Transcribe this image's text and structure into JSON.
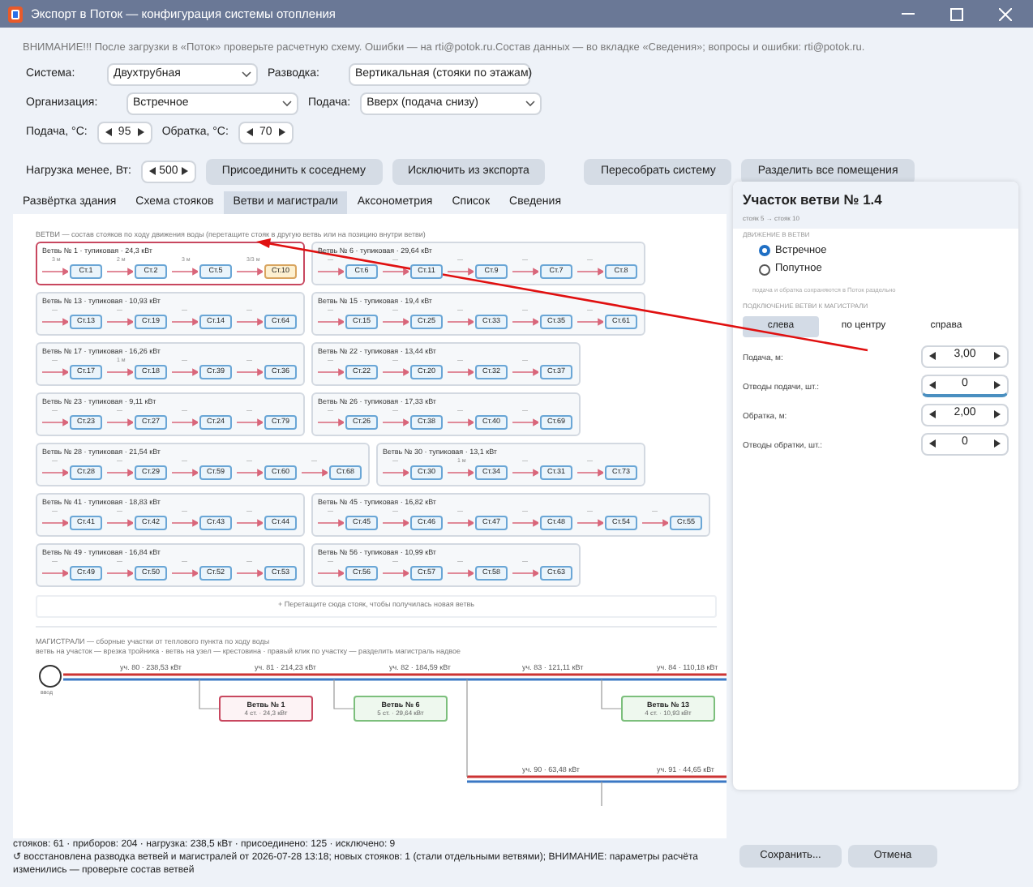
{
  "window": {
    "title": "Экспорт в Поток — конфигурация системы отопления"
  },
  "notice": "ВНИМАНИЕ!!! После загрузки в «Поток» проверьте расчетную схему. Ошибки — на rti@potok.ru.Состав данных — во вкладке «Сведения»; вопросы и ошибки: rti@potok.ru.",
  "form_rows": [
    [
      {
        "kind": "select",
        "label": "Система:",
        "value": "Двухтрубная"
      },
      {
        "kind": "select",
        "label": "Разводка:",
        "value": "Вертикальная (стояки по этажам)"
      }
    ],
    [
      {
        "kind": "select",
        "label": "Организация:",
        "value": "Встречное"
      },
      {
        "kind": "select",
        "label": "Подача:",
        "value": "Вверх (подача снизу)"
      }
    ],
    [
      {
        "kind": "spin",
        "label": "Подача, °C:",
        "value": "95"
      },
      {
        "kind": "spin",
        "label": "Обратка, °C:",
        "value": "70"
      }
    ],
    [
      {
        "kind": "spin",
        "label": "Нагрузка менее, Вт:",
        "value": "500"
      },
      {
        "kind": "button",
        "label": "Присоединить к соседнему"
      },
      {
        "kind": "button",
        "label": "Исключить из экспорта"
      },
      {
        "kind": "gap"
      },
      {
        "kind": "button",
        "label": "Пересобрать систему"
      },
      {
        "kind": "button",
        "label": "Разделить все помещения"
      }
    ]
  ],
  "tabs": [
    {
      "label": "Развёртка здания",
      "selected": false
    },
    {
      "label": "Схема стояков",
      "selected": false
    },
    {
      "label": "Ветви и магистрали",
      "selected": true
    },
    {
      "label": "Аксонометрия",
      "selected": false
    },
    {
      "label": "Список",
      "selected": false
    },
    {
      "label": "Сведения",
      "selected": false
    }
  ],
  "branches": {
    "caption": "ВЕТВИ — состав стояков по ходу движения воды (перетащите стояк в другую ветвь или на позицию внутри ветви)",
    "items": [
      {
        "title": "Ветвь № 1 · тупиковая · 24,3 кВт",
        "selected": true,
        "stations": [
          {
            "name": "Ст.1",
            "length": "3 м",
            "selected": false
          },
          {
            "name": "Ст.2",
            "length": "2 м",
            "selected": false
          },
          {
            "name": "Ст.5",
            "length": "3 м",
            "selected": false
          },
          {
            "name": "Ст.10",
            "length": "3/3 м",
            "selected": true
          }
        ]
      },
      {
        "title": "Ветвь № 6 · тупиковая · 29,64 кВт",
        "selected": false,
        "stations": [
          {
            "name": "Ст.6",
            "length": "—",
            "selected": false
          },
          {
            "name": "Ст.11",
            "length": "—",
            "selected": false
          },
          {
            "name": "Ст.9",
            "length": "—",
            "selected": false
          },
          {
            "name": "Ст.7",
            "length": "—",
            "selected": false
          },
          {
            "name": "Ст.8",
            "length": "—",
            "selected": false
          }
        ]
      },
      {
        "title": "Ветвь № 13 · тупиковая · 10,93 кВт",
        "selected": false,
        "stations": [
          {
            "name": "Ст.13",
            "length": "—",
            "selected": false
          },
          {
            "name": "Ст.19",
            "length": "—",
            "selected": false
          },
          {
            "name": "Ст.14",
            "length": "—",
            "selected": false
          },
          {
            "name": "Ст.64",
            "length": "—",
            "selected": false
          }
        ]
      },
      {
        "title": "Ветвь № 15 · тупиковая · 19,4 кВт",
        "selected": false,
        "stations": [
          {
            "name": "Ст.15",
            "length": "—",
            "selected": false
          },
          {
            "name": "Ст.25",
            "length": "—",
            "selected": false
          },
          {
            "name": "Ст.33",
            "length": "—",
            "selected": false
          },
          {
            "name": "Ст.35",
            "length": "—",
            "selected": false
          },
          {
            "name": "Ст.61",
            "length": "—",
            "selected": false
          }
        ]
      },
      {
        "title": "Ветвь № 17 · тупиковая · 16,26 кВт",
        "selected": false,
        "stations": [
          {
            "name": "Ст.17",
            "length": "—",
            "selected": false
          },
          {
            "name": "Ст.18",
            "length": "1 м",
            "selected": false
          },
          {
            "name": "Ст.39",
            "length": "—",
            "selected": false
          },
          {
            "name": "Ст.36",
            "length": "—",
            "selected": false
          }
        ]
      },
      {
        "title": "Ветвь № 22 · тупиковая · 13,44 кВт",
        "selected": false,
        "stations": [
          {
            "name": "Ст.22",
            "length": "—",
            "selected": false
          },
          {
            "name": "Ст.20",
            "length": "—",
            "selected": false
          },
          {
            "name": "Ст.32",
            "length": "—",
            "selected": false
          },
          {
            "name": "Ст.37",
            "length": "—",
            "selected": false
          }
        ]
      },
      {
        "title": "Ветвь № 23 · тупиковая · 9,11 кВт",
        "selected": false,
        "stations": [
          {
            "name": "Ст.23",
            "length": "—",
            "selected": false
          },
          {
            "name": "Ст.27",
            "length": "—",
            "selected": false
          },
          {
            "name": "Ст.24",
            "length": "—",
            "selected": false
          },
          {
            "name": "Ст.79",
            "length": "—",
            "selected": false
          }
        ]
      },
      {
        "title": "Ветвь № 26 · тупиковая · 17,33 кВт",
        "selected": false,
        "stations": [
          {
            "name": "Ст.26",
            "length": "—",
            "selected": false
          },
          {
            "name": "Ст.38",
            "length": "—",
            "selected": false
          },
          {
            "name": "Ст.40",
            "length": "—",
            "selected": false
          },
          {
            "name": "Ст.69",
            "length": "—",
            "selected": false
          }
        ]
      },
      {
        "title": "Ветвь № 28 · тупиковая · 21,54 кВт",
        "selected": false,
        "stations": [
          {
            "name": "Ст.28",
            "length": "—",
            "selected": false
          },
          {
            "name": "Ст.29",
            "length": "—",
            "selected": false
          },
          {
            "name": "Ст.59",
            "length": "—",
            "selected": false
          },
          {
            "name": "Ст.60",
            "length": "—",
            "selected": false
          },
          {
            "name": "Ст.68",
            "length": "—",
            "selected": false
          }
        ]
      },
      {
        "title": "Ветвь № 30 · тупиковая · 13,1 кВт",
        "selected": false,
        "stations": [
          {
            "name": "Ст.30",
            "length": "—",
            "selected": false
          },
          {
            "name": "Ст.34",
            "length": "1 м",
            "selected": false
          },
          {
            "name": "Ст.31",
            "length": "—",
            "selected": false
          },
          {
            "name": "Ст.73",
            "length": "—",
            "selected": false
          }
        ]
      },
      {
        "title": "Ветвь № 41 · тупиковая · 18,83 кВт",
        "selected": false,
        "stations": [
          {
            "name": "Ст.41",
            "length": "—",
            "selected": false
          },
          {
            "name": "Ст.42",
            "length": "—",
            "selected": false
          },
          {
            "name": "Ст.43",
            "length": "—",
            "selected": false
          },
          {
            "name": "Ст.44",
            "length": "—",
            "selected": false
          }
        ]
      },
      {
        "title": "Ветвь № 45 · тупиковая · 16,82 кВт",
        "selected": false,
        "stations": [
          {
            "name": "Ст.45",
            "length": "—",
            "selected": false
          },
          {
            "name": "Ст.46",
            "length": "—",
            "selected": false
          },
          {
            "name": "Ст.47",
            "length": "—",
            "selected": false
          },
          {
            "name": "Ст.48",
            "length": "—",
            "selected": false
          },
          {
            "name": "Ст.54",
            "length": "—",
            "selected": false
          },
          {
            "name": "Ст.55",
            "length": "—",
            "selected": false
          }
        ]
      },
      {
        "title": "Ветвь № 49 · тупиковая · 16,84 кВт",
        "selected": false,
        "stations": [
          {
            "name": "Ст.49",
            "length": "—",
            "selected": false
          },
          {
            "name": "Ст.50",
            "length": "—",
            "selected": false
          },
          {
            "name": "Ст.52",
            "length": "—",
            "selected": false
          },
          {
            "name": "Ст.53",
            "length": "—",
            "selected": false
          }
        ]
      },
      {
        "title": "Ветвь № 56 · тупиковая · 10,99 кВт",
        "selected": false,
        "stations": [
          {
            "name": "Ст.56",
            "length": "—",
            "selected": false
          },
          {
            "name": "Ст.57",
            "length": "—",
            "selected": false
          },
          {
            "name": "Ст.58",
            "length": "—",
            "selected": false
          },
          {
            "name": "Ст.63",
            "length": "—",
            "selected": false
          }
        ]
      }
    ],
    "drop_hint": "+ Перетащите сюда стояк, чтобы получилась новая ветвь"
  },
  "mains": {
    "caption": "МАГИСТРАЛИ — сборные участки от теплового пункта по ходу воды",
    "hint": "ветвь на участок — врезка тройника · ветвь на узел — крестовина · правый клик по участку — разделить магистраль надвое",
    "node_label": "ввод",
    "segments": [
      "уч. 80 · 238,53 кВт",
      "уч. 81 · 214,23 кВт",
      "уч. 82 · 184,59 кВт",
      "уч. 83 · 121,11 кВт",
      "уч. 84 · 110,18 кВт"
    ],
    "lower_segments": [
      "уч. 90 · 63,48 кВт",
      "уч. 91 · 44,65 кВт"
    ],
    "branches": [
      {
        "title": "Ветвь № 1",
        "subtitle": "4 ст. · 24,3 кВт",
        "selected": true
      },
      {
        "title": "Ветвь № 6",
        "subtitle": "5 ст. · 29,64 кВт",
        "selected": false
      },
      {
        "title": "Ветвь № 13",
        "subtitle": "4 ст. · 10,93 кВт",
        "selected": false
      }
    ]
  },
  "panel": {
    "title": "Участок ветви № 1.4",
    "subtitle": "стояк 5 → стояк 10",
    "flow_label": "ДВИЖЕНИЕ В ВЕТВИ",
    "flow_options": [
      {
        "label": "Встречное",
        "selected": true
      },
      {
        "label": "Попутное",
        "selected": false
      }
    ],
    "flow_note": "подача и обратка сохраняются в Поток раздельно",
    "connect_label": "ПОДКЛЮЧЕНИЕ ВЕТВИ К МАГИСТРАЛИ",
    "connect_options": [
      {
        "label": "слева",
        "selected": true
      },
      {
        "label": "по центру",
        "selected": false
      },
      {
        "label": "справа",
        "selected": false
      }
    ],
    "fields": [
      {
        "label": "Подача, м:",
        "value": "3,00",
        "focused": false
      },
      {
        "label": "Отводы подачи, шт.:",
        "value": "0",
        "focused": true
      },
      {
        "label": "Обратка, м:",
        "value": "2,00",
        "focused": false
      },
      {
        "label": "Отводы обратки, шт.:",
        "value": "0",
        "focused": false
      }
    ]
  },
  "status": {
    "lines": [
      "стояков: 61 · приборов: 204 · нагрузка: 238,5 кВт · присоединено: 125 · исключено: 9",
      "↺ восстановлена разводка ветвей и магистралей от 2026-07-28 13:18; новых стояков: 1 (стали отдельными ветвями); ВНИМАНИЕ: параметры расчёта изменились — проверьте состав ветвей"
    ],
    "buttons": [
      "Сохранить...",
      "Отмена"
    ]
  }
}
